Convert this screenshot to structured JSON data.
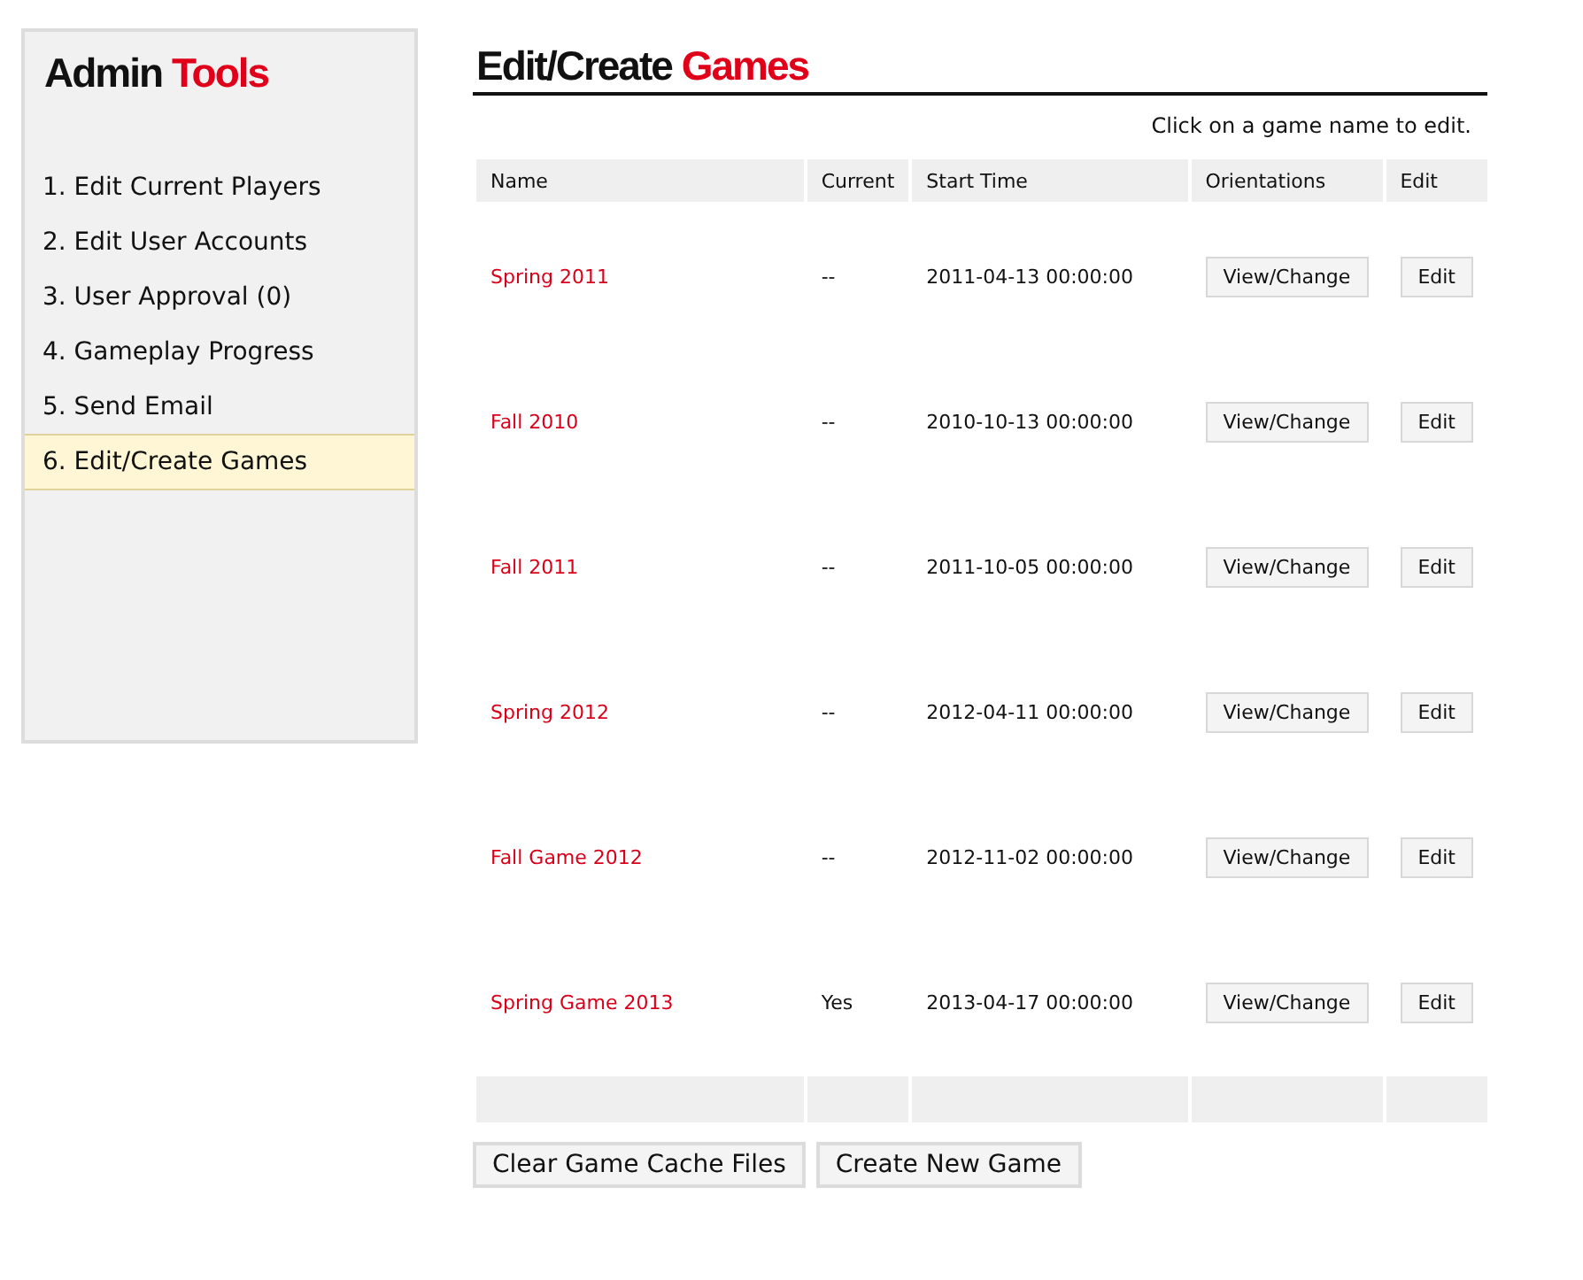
{
  "sidebar": {
    "title_parts": [
      "Admin",
      "Tools"
    ],
    "items": [
      {
        "label": "1. Edit Current Players",
        "selected": false
      },
      {
        "label": "2. Edit User Accounts",
        "selected": false
      },
      {
        "label": "3. User Approval (0)",
        "selected": false
      },
      {
        "label": "4. Gameplay Progress",
        "selected": false
      },
      {
        "label": "5. Send Email",
        "selected": false
      },
      {
        "label": "6. Edit/Create Games",
        "selected": true
      }
    ]
  },
  "main": {
    "title_parts": [
      "Edit/Create",
      "Games"
    ],
    "hint": "Click on a game name to edit.",
    "table": {
      "columns": [
        "Name",
        "Current",
        "Start Time",
        "Orientations",
        "Edit"
      ],
      "rows": [
        {
          "name": "Spring 2011",
          "current": "--",
          "start_time": "2011-04-13 00:00:00",
          "orientations_button": "View/Change",
          "edit_button": "Edit"
        },
        {
          "name": "Fall 2010",
          "current": "--",
          "start_time": "2010-10-13 00:00:00",
          "orientations_button": "View/Change",
          "edit_button": "Edit"
        },
        {
          "name": "Fall 2011",
          "current": "--",
          "start_time": "2011-10-05 00:00:00",
          "orientations_button": "View/Change",
          "edit_button": "Edit"
        },
        {
          "name": "Spring 2012",
          "current": "--",
          "start_time": "2012-04-11 00:00:00",
          "orientations_button": "View/Change",
          "edit_button": "Edit"
        },
        {
          "name": "Fall Game 2012",
          "current": "--",
          "start_time": "2012-11-02 00:00:00",
          "orientations_button": "View/Change",
          "edit_button": "Edit"
        },
        {
          "name": "Spring Game 2013",
          "current": "Yes",
          "start_time": "2013-04-17 00:00:00",
          "orientations_button": "View/Change",
          "edit_button": "Edit"
        }
      ]
    },
    "buttons": [
      "Clear Game Cache Files",
      "Create New Game"
    ]
  }
}
